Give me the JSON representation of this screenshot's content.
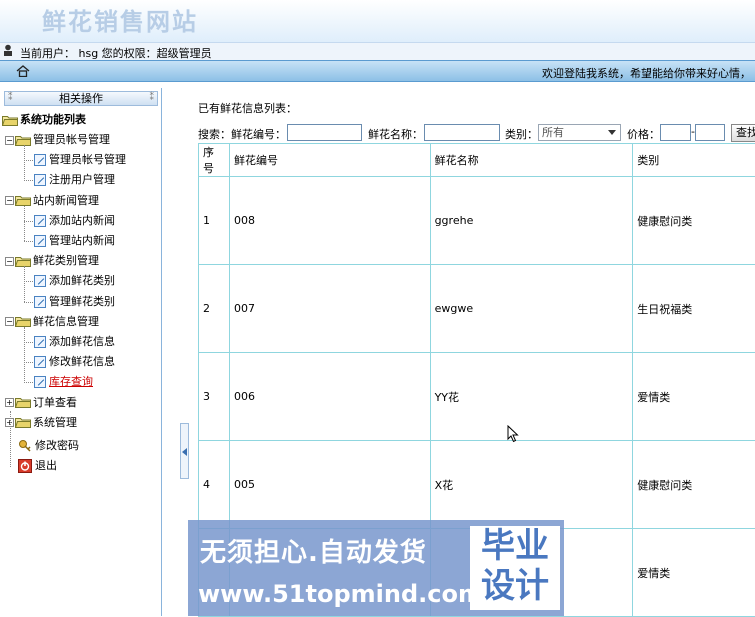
{
  "site": {
    "title": "鲜花销售网站"
  },
  "userbar": {
    "text": "当前用户： hsg 您的权限：超级管理员"
  },
  "navbar": {
    "welcome": "欢迎登陆我系统，希望能给你带来好心情，",
    "home_icon": "home-icon"
  },
  "sidebar": {
    "header": "相关操作",
    "root": "系统功能列表",
    "groups": [
      {
        "label": "管理员帐号管理",
        "items": [
          "管理员帐号管理",
          "注册用户管理"
        ]
      },
      {
        "label": "站内新闻管理",
        "items": [
          "添加站内新闻",
          "管理站内新闻"
        ]
      },
      {
        "label": "鲜花类别管理",
        "items": [
          "添加鲜花类别",
          "管理鲜花类别"
        ]
      },
      {
        "label": "鲜花信息管理",
        "items": [
          "添加鲜花信息",
          "修改鲜花信息",
          "库存查询"
        ]
      },
      {
        "label": "订单查看",
        "items": []
      },
      {
        "label": "系统管理",
        "items": []
      }
    ],
    "change_password": "修改密码",
    "logout": "退出",
    "active_item_color": "#cc0000"
  },
  "main": {
    "list_title": "已有鲜花信息列表：",
    "search": {
      "label": "搜索：",
      "code_label": "鲜花编号：",
      "code_value": "",
      "name_label": "鲜花名称：",
      "name_value": "",
      "category_label": "类别：",
      "category_selected": "所有",
      "price_label": "价格：",
      "price_sep": "-",
      "button": "查找"
    },
    "table": {
      "headers": [
        "序号",
        "鲜花编号",
        "鲜花名称",
        "类别"
      ],
      "rows": [
        [
          "1",
          "008",
          "ggrehe",
          "健康慰问类"
        ],
        [
          "2",
          "007",
          "ewgwe",
          "生日祝福类"
        ],
        [
          "3",
          "006",
          "YY花",
          "爱情类"
        ],
        [
          "4",
          "005",
          "X花",
          "健康慰问类"
        ],
        [
          "",
          "",
          "",
          "爱情类"
        ]
      ]
    }
  },
  "watermark": {
    "line1": "无须担心.自动发货",
    "line2": "www.51topmind.com",
    "right1": "毕业",
    "right2": "设计"
  },
  "colors": {
    "accent": "#5b9bd0",
    "table_border": "#8fd6df",
    "title": "#b7cde6"
  }
}
